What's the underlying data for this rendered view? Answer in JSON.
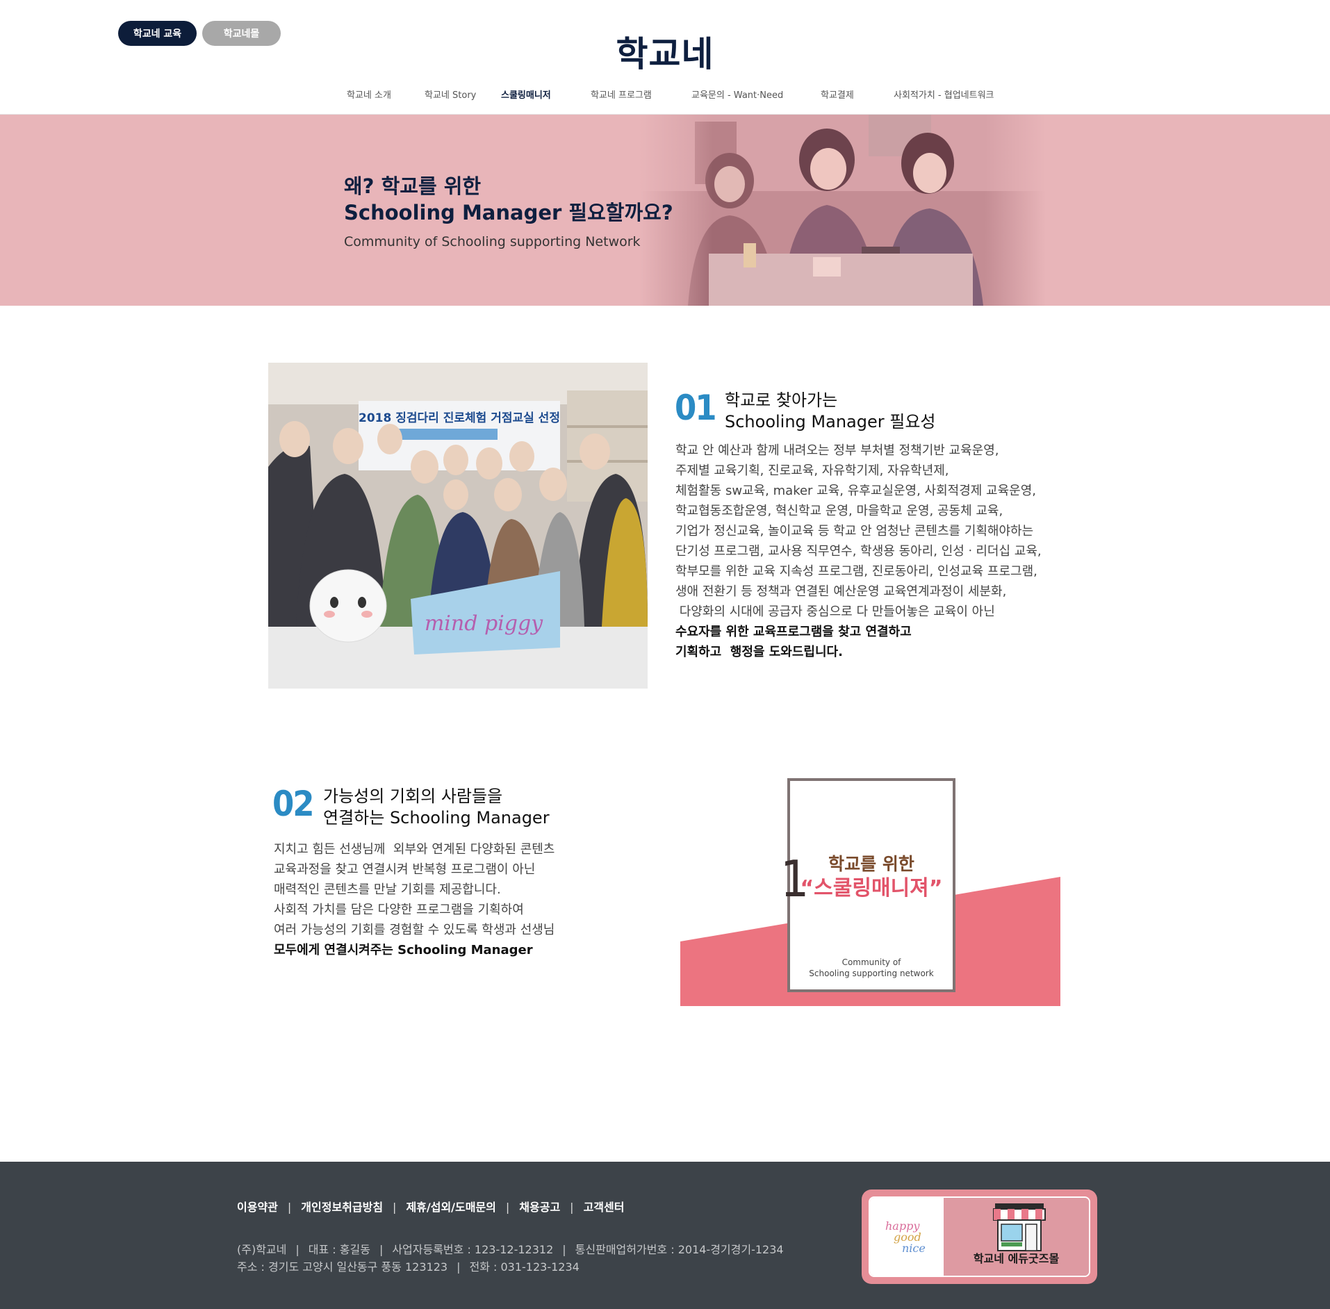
{
  "header": {
    "pill_edu": "학교네 교육",
    "pill_mall": "학교네몰",
    "site_title": "학교네",
    "nav": [
      {
        "label": "학교네 소개"
      },
      {
        "label": "학교네 Story"
      },
      {
        "label": "스쿨링매니저",
        "active": true
      },
      {
        "label": "학교네 프로그램"
      },
      {
        "label": "교육문의 - Want·Need"
      },
      {
        "label": "학교결제"
      },
      {
        "label": "사회적가치 - 협업네트워크"
      }
    ]
  },
  "hero": {
    "title_line1": "왜? 학교를 위한",
    "title_line2": "Schooling Manager 필요할까요?",
    "subtitle": "Community of Schooling supporting Network",
    "bg_color": "#e8b5b9"
  },
  "section1": {
    "number": "01",
    "title_line1": "학교로 찾아가는",
    "title_line2": "Schooling Manager 필요성",
    "photo_banner": "2018 징검다리 진로체험 거점교실 선정",
    "photo_sign": "mind piggy",
    "body": [
      "학교 안 예산과 함께 내려오는 정부 부처별 정책기반 교육운영,",
      "주제별 교육기획, 진로교육, 자유학기제, 자유학년제,",
      "체험활동 sw교육, maker 교육, 유후교실운영, 사회적경제 교육운영,",
      "학교협동조합운영, 혁신학교 운영, 마을학교 운영, 공동체 교육,",
      "기업가 정신교육, 놀이교육 등 학교 안 엄청난 콘텐츠를 기획해야하는",
      "단기성 프로그램, 교사용 직무연수, 학생용 동아리, 인성ㆍ리더십 교육,",
      "학부모를 위한 교육 지속성 프로그램, 진로동아리, 인성교육 프로그램,",
      "생애 전환기 등 정책과 연결된 예산운영 교육연계과정이 세분화,",
      " 다양화의 시대에 공급자 중심으로 다 만들어놓은 교육이 아닌"
    ],
    "body_bold": [
      "수요자를 위한 교육프로그램을 찾고 연결하고",
      "기획하고  행정을 도와드립니다."
    ]
  },
  "section2": {
    "number": "02",
    "title_line1": "가능성의 기회의 사람들을",
    "title_line2": "연결하는 Schooling Manager",
    "body": [
      "지치고 힘든 선생님께  외부와 연계된 다양화된 콘텐츠",
      "교육과정을 찾고 연결시켜 반복형 프로그램이 아닌",
      "매력적인 콘텐츠를 만날 기회를 제공합니다.",
      "사회적 가치를 담은 다양한 프로그램을 기획하여",
      "여러 가능성의 기회를 경험할 수 있도록 학생과 선생님"
    ],
    "body_bold": "모두에게 연결시켜주는 Schooling Manager",
    "promo": {
      "big_num": "1",
      "line1": "학교를 위한",
      "line2": "“스쿨링매니져”",
      "small1": "Community of",
      "small2": "Schooling supporting network",
      "accent": "#ec7480"
    }
  },
  "footer": {
    "links": [
      "이용약관",
      "개인정보취급방침",
      "제휴/섭외/도매문의",
      "채용공고",
      "고객센터"
    ],
    "link_sep": "|",
    "info_line1": [
      "(주)학교네",
      "대표 : 홍길동",
      "사업자등록번호 : 123-12-12312",
      "통신판매업허가번호 : 2014-경기경기-1234"
    ],
    "info_line2": [
      "주소 : 경기도 고양시 일산동구 풍동 123123",
      "전화 : 031-123-1234"
    ],
    "badge_label": "학교네 에듀굿즈몰",
    "badge_logo": [
      "happy",
      "good",
      "nice"
    ]
  }
}
